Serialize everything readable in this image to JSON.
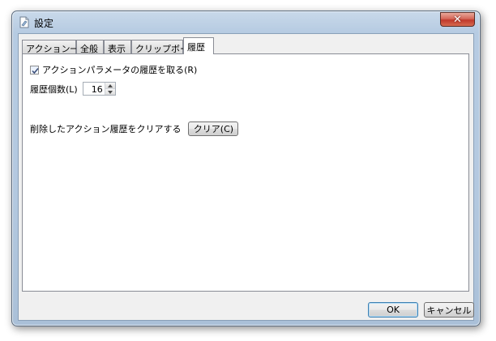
{
  "window": {
    "title": "設定",
    "close_glyph": "✕"
  },
  "tabs": [
    {
      "label": "アクション一覧",
      "active": false
    },
    {
      "label": "全般",
      "active": false
    },
    {
      "label": "表示",
      "active": false
    },
    {
      "label": "クリップボード",
      "active": false
    },
    {
      "label": "履歴",
      "active": true
    }
  ],
  "history": {
    "record_checkbox_label": "アクションパラメータの履歴を取る(R)",
    "record_checked": true,
    "count_label": "履歴個数(L)",
    "count_value": "16",
    "clear_label": "削除したアクション履歴をクリアする",
    "clear_button": "クリア(C)"
  },
  "footer": {
    "ok_label": "OK",
    "cancel_label": "キャンセル"
  },
  "icons": {
    "app": "settings-page-icon",
    "close": "close-icon",
    "check": "check-icon",
    "spin_up": "arrow-up-icon",
    "spin_down": "arrow-down-icon"
  }
}
